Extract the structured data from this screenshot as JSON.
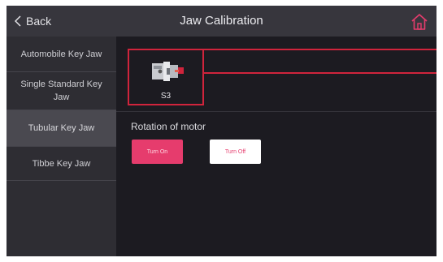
{
  "header": {
    "back_label": "Back",
    "title": "Jaw Calibration",
    "home_icon": "home-icon"
  },
  "sidebar": {
    "items": [
      {
        "label": "Automobile Key Jaw",
        "active": false
      },
      {
        "label": "Single Standard Key Jaw",
        "active": false
      },
      {
        "label": "Tubular Key Jaw",
        "active": true
      },
      {
        "label": "Tibbe Key Jaw",
        "active": false
      }
    ]
  },
  "main": {
    "jaw_card": {
      "label": "S3",
      "icon": "jaw-clamp-icon"
    },
    "section_label": "Rotation of motor",
    "buttons": {
      "turn_on": "Turn On",
      "turn_off": "Turn Off"
    }
  },
  "colors": {
    "accent": "#e63c6d",
    "highlight_border": "#d0243c",
    "header_bg": "#37363d",
    "sidebar_bg": "#2e2d33",
    "main_bg": "#1c1b21"
  }
}
